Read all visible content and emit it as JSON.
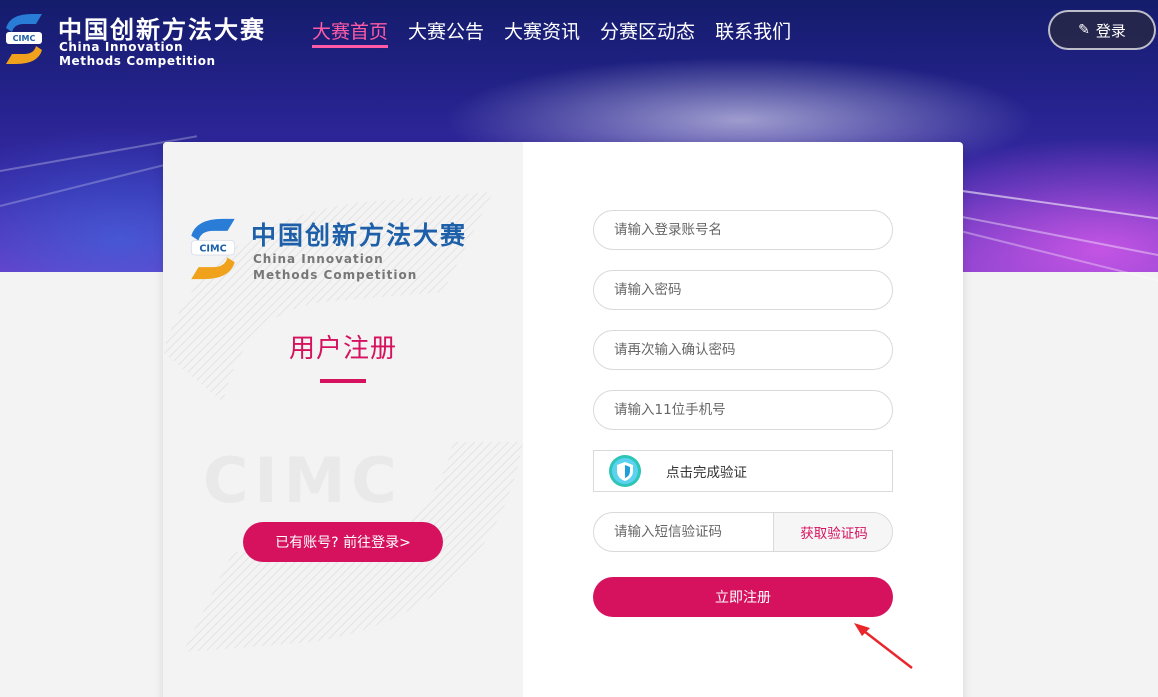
{
  "header": {
    "brand_cn": "中国创新方法大赛",
    "brand_en_line1": "China Innovation",
    "brand_en_line2": "Methods Competition",
    "logo_text": "CIMC",
    "nav": [
      {
        "label": "大赛首页",
        "active": true
      },
      {
        "label": "大赛公告",
        "active": false
      },
      {
        "label": "大赛资讯",
        "active": false
      },
      {
        "label": "分赛区动态",
        "active": false
      },
      {
        "label": "联系我们",
        "active": false
      }
    ],
    "login_label": "登录",
    "login_icon": "pen-icon"
  },
  "card": {
    "brand_cn": "中国创新方法大赛",
    "brand_en_line1": "China Innovation",
    "brand_en_line2": "Methods Competition",
    "watermark_text": "CIMC",
    "title": "用户注册",
    "goto_login_label": "已有账号? 前往登录>",
    "form": {
      "username_placeholder": "请输入登录账号名",
      "password_placeholder": "请输入密码",
      "confirm_password_placeholder": "请再次输入确认密码",
      "phone_placeholder": "请输入11位手机号",
      "captcha_label": "点击完成验证",
      "sms_placeholder": "请输入短信验证码",
      "sms_button_label": "获取验证码",
      "submit_label": "立即注册"
    }
  },
  "colors": {
    "accent": "#d6125f",
    "nav_active": "#ff5aa5",
    "brand_blue": "#1d5fa8",
    "logo_orange": "#f0a21c"
  }
}
